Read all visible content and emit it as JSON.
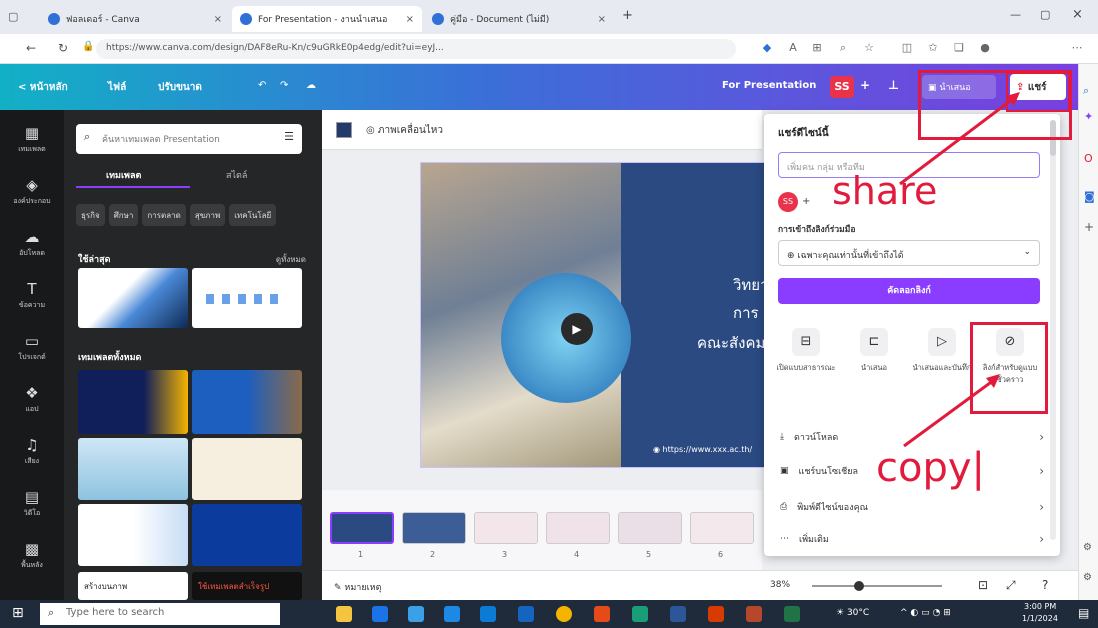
{
  "browser": {
    "tabs": [
      {
        "label": "ฟอลเดอร์ - Canva"
      },
      {
        "label": "For Presentation - งานนำเสนอ"
      },
      {
        "label": "คู่มือ - Document (ไม่มี)"
      }
    ],
    "new_tab": "+",
    "url": "https://www.canva.com/design/DAF8eRu-Kn/c9uGRkE0p4edg/edit?ui=eyJ...",
    "icons": [
      "back-icon",
      "refresh-icon",
      "lock-icon",
      "star-icon",
      "extensions-icon",
      "profile-icon",
      "more-icon"
    ]
  },
  "canva_header": {
    "home": "< หน้าหลัก",
    "file": "ไฟล์",
    "resize": "ปรับขนาด",
    "doc_title": "For Presentation",
    "avatar": "SS",
    "plus": "+",
    "present": "นำเสนอ",
    "share": "แชร์"
  },
  "rail": [
    {
      "label": "เทมเพลต",
      "icon": "template-icon"
    },
    {
      "label": "องค์ประกอบ",
      "icon": "elements-icon"
    },
    {
      "label": "อัปโหลด",
      "icon": "upload-icon"
    },
    {
      "label": "ข้อความ",
      "icon": "text-icon"
    },
    {
      "label": "โปรเจกต์",
      "icon": "projects-icon"
    },
    {
      "label": "แอป",
      "icon": "apps-icon"
    },
    {
      "label": "เสียง",
      "icon": "audio-icon"
    },
    {
      "label": "วิดีโอ",
      "icon": "video-icon"
    },
    {
      "label": "พื้นหลัง",
      "icon": "background-icon"
    }
  ],
  "left_panel": {
    "search_placeholder": "ค้นหาเทมเพลต Presentation",
    "tabs": [
      "เทมเพลต",
      "สไตล์"
    ],
    "chips": [
      "ธุรกิจ",
      "ศึกษา",
      "การตลาด",
      "สุขภาพ",
      "เทคโนโลยี"
    ],
    "recent_title": "ใช้ล่าสุด",
    "recent_link": "ดูทั้งหมด",
    "all_title": "เทมเพลตทั้งหมด",
    "bottom_card_label": "สร้างบนภาพ",
    "bottom_card_label2": "ใช้เทมเพลตสำเร็จรูป"
  },
  "editor": {
    "animate": "ภาพเคลื่อนไหว",
    "slide_title_lines": [
      "วิทยา",
      "การ",
      "คณะสังคม"
    ],
    "slide_footer": "https://www.xxx.ac.th/",
    "pages": [
      "1",
      "2",
      "3",
      "4",
      "5",
      "6"
    ],
    "notes": "หมายเหตุ",
    "zoom": "38%"
  },
  "share_panel": {
    "title": "แชร์ดีไซน์นี้",
    "input_placeholder": "เพิ่มคน กลุ่ม หรือทีม",
    "avatar": "SS",
    "access_label": "การเข้าถึงลิงก์ร่วมมือ",
    "access_value": "เฉพาะคุณเท่านั้นที่เข้าถึงได้",
    "copy_link": "คัดลอกลิงก์",
    "options": [
      {
        "label": "เปิดแบบสาธารณะ",
        "icon": "public-view-icon"
      },
      {
        "label": "นำเสนอ",
        "icon": "present-icon"
      },
      {
        "label": "นำเสนอและบันทึก",
        "icon": "record-icon"
      },
      {
        "label": "ลิงก์สำหรับดูแบบชั่วคราว",
        "icon": "template-link-icon"
      }
    ],
    "rows": [
      {
        "label": "ดาวน์โหลด",
        "icon": "download-icon"
      },
      {
        "label": "แชร์บนโซเชียล",
        "icon": "social-icon"
      },
      {
        "label": "พิมพ์ดีไซน์ของคุณ",
        "icon": "print-icon"
      },
      {
        "label": "เพิ่มเติม",
        "icon": "more-dots-icon"
      }
    ]
  },
  "annotations": {
    "share_text": "share",
    "copy_text": "copy|",
    "color": "#e21b3c"
  },
  "taskbar": {
    "search_placeholder": "Type here to search",
    "weather": "30°C",
    "time": "3:00 PM",
    "date": "1/1/2024"
  }
}
